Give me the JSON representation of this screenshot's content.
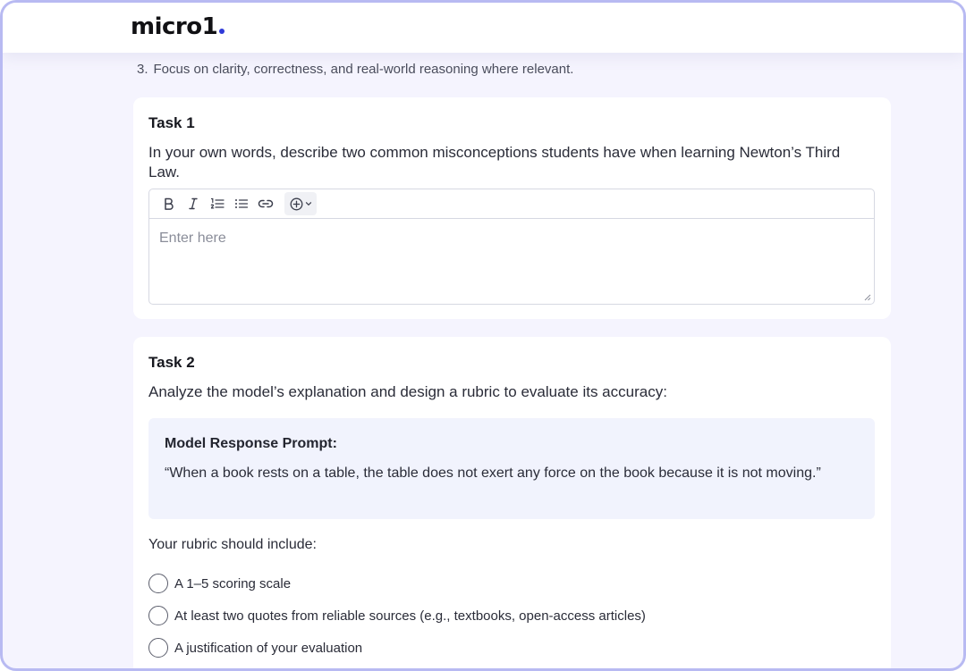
{
  "header": {
    "logo_text": "micro1",
    "accent_color": "#2f3ad8"
  },
  "intro": {
    "item_number": "3.",
    "item_text": "Focus on clarity, correctness, and real-world reasoning where relevant."
  },
  "task1": {
    "title": "Task 1",
    "question": "In your own words, describe two common misconceptions students have when learning Newton’s Third Law.",
    "editor": {
      "placeholder": "Enter here",
      "toolbar": [
        "bold-icon",
        "italic-icon",
        "ordered-list-icon",
        "bullet-list-icon",
        "link-icon",
        "insert-plus-icon"
      ]
    }
  },
  "task2": {
    "title": "Task 2",
    "question": "Analyze the model’s explanation and design a rubric to evaluate its accuracy:",
    "prompt_box": {
      "label": "Model Response Prompt:",
      "text": "“When a book rests on a table, the table does not exert any force on the book because it is not moving.”"
    },
    "rubric_intro": "Your rubric should include:",
    "options": [
      {
        "label": "A 1–5 scoring scale",
        "checked": false
      },
      {
        "label": "At least two quotes from reliable sources (e.g., textbooks, open-access articles)",
        "checked": false
      },
      {
        "label": "A justification of your evaluation",
        "checked": false
      }
    ]
  }
}
